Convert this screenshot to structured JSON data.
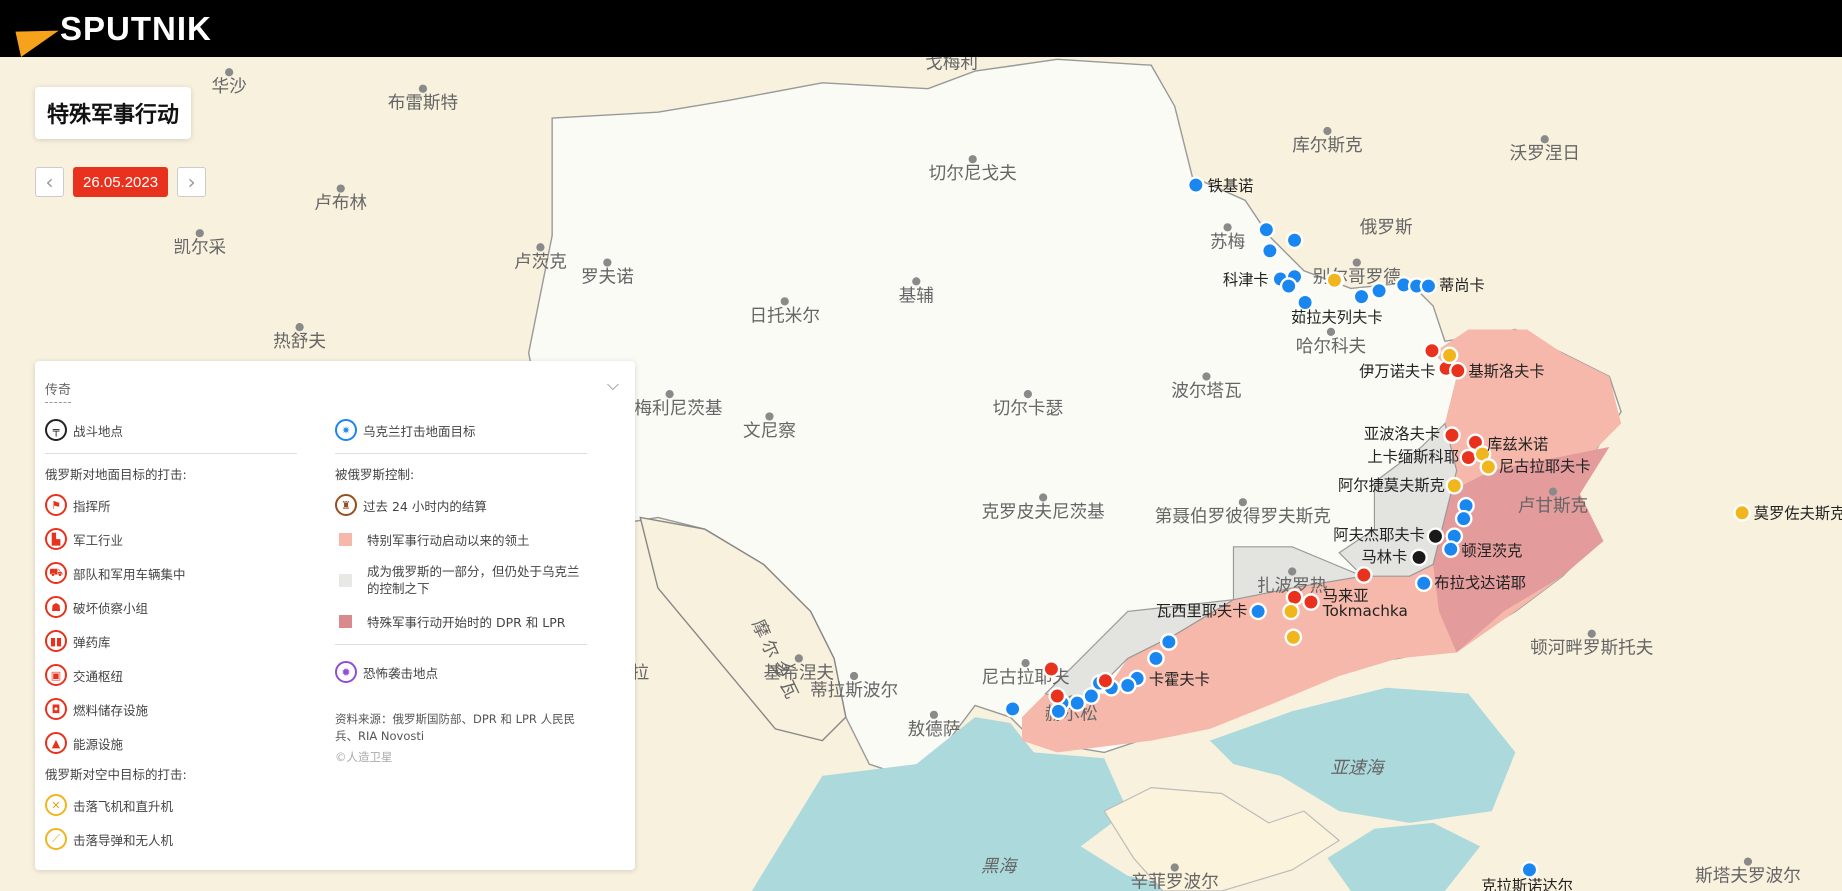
{
  "header": {
    "brand": "SPUTNIK"
  },
  "title": "特殊军事行动",
  "date_nav": {
    "date": "26.05.2023",
    "prev": "‹",
    "next": "›"
  },
  "colors": {
    "ukraine_strike": "#1a87f0",
    "russia_ground_strike": "#e8321d",
    "air_strike": "#f1b51d",
    "combat": "#1a1a1a",
    "occupied": "#f6b8ab",
    "dpr_lpr": "#e39b9c",
    "annexed_uncontrolled": "#e3e3df",
    "sea": "#acd9dc"
  },
  "legend": {
    "title": "传奇",
    "combat": "战斗地点",
    "ukraine_strike": "乌克兰打击地面目标",
    "ground_heading": "俄罗斯对地面目标的打击:",
    "ground_items": [
      "指挥所",
      "军工行业",
      "部队和军用车辆集中",
      "破坏侦察小组",
      "弹药库",
      "交通枢纽",
      "燃料储存设施",
      "能源设施"
    ],
    "air_heading": "俄罗斯对空中目标的打击:",
    "air_items": [
      "击落飞机和直升机",
      "击落导弹和无人机"
    ],
    "control_heading": "被俄罗斯控制:",
    "control_items": [
      "过去 24 小时内的结算",
      "特别军事行动启动以来的领土",
      "成为俄罗斯的一部分，但仍处于乌克兰的控制之下",
      "特殊军事行动开始时的 DPR 和 LPR"
    ],
    "terror": "恐怖袭击地点",
    "source": "资料来源：俄罗斯国防部、DPR 和 LPR 人民民兵、RIA Novosti",
    "copyright": "©人造卫星"
  },
  "cities": [
    "戈梅利",
    "华沙",
    "布雷斯特",
    "库尔斯克",
    "沃罗涅日",
    "切尔尼戈夫",
    "卢布林",
    "凯尔采",
    "俄罗斯",
    "苏梅",
    "卢茨克",
    "罗夫诺",
    "基辅",
    "日托米尔",
    "热舒夫",
    "哈尔科夫",
    "波尔塔瓦",
    "切尔卡瑟",
    "赫梅利尼茨基",
    "文尼察",
    "克罗皮夫尼茨基",
    "第聂伯罗彼得罗夫斯克",
    "卢甘斯克",
    "摩尔多瓦",
    "基希涅夫",
    "蒂拉斯波尔",
    "尼古拉耶夫",
    "敖德萨",
    "扎波罗热",
    "赫尔松",
    "顿河畔罗斯托夫",
    "亚速海",
    "黑海",
    "辛菲罗波尔",
    "斯塔夫罗波尔",
    "别尔哥罗德",
    "拉"
  ],
  "marker_labels": [
    "铁基诺",
    "科津卡",
    "茹拉夫列夫卡",
    "蒂尚卡",
    "伊万诺夫卡",
    "基斯洛夫卡",
    "亚波洛夫卡",
    "库兹米诺",
    "上卡缅斯科耶",
    "尼古拉耶夫卡",
    "阿尔捷莫夫斯克",
    "阿夫杰耶夫卡",
    "顿涅茨克",
    "马林卡",
    "布拉戈达诺耶",
    "马来亚",
    "Tokmachka",
    "瓦西里耶夫卡",
    "卡霍夫卡",
    "莫罗佐夫斯克",
    "克拉斯诺达尔"
  ]
}
